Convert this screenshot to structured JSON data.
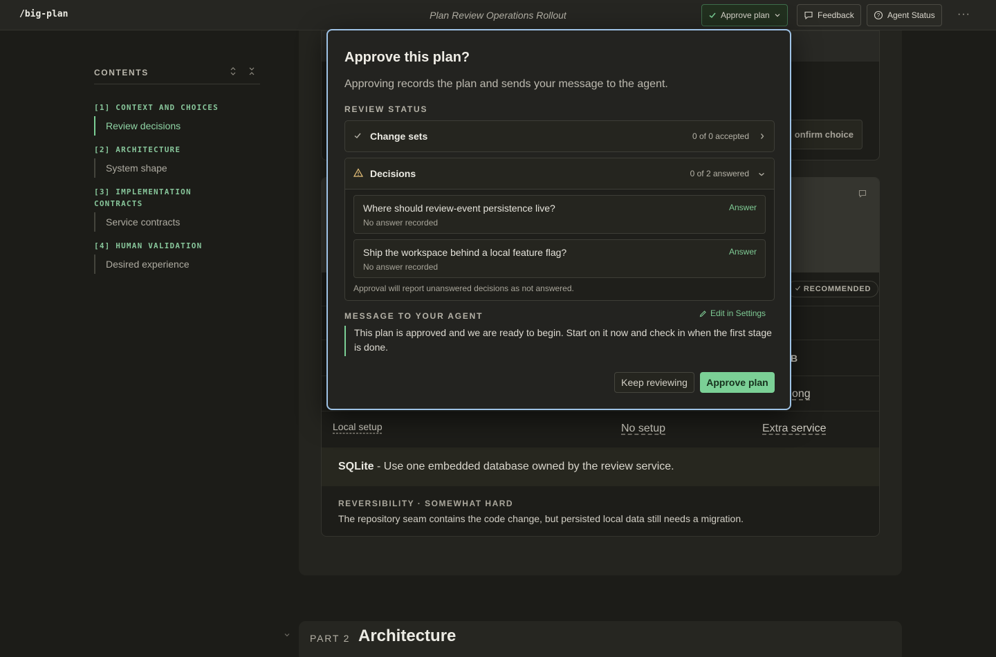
{
  "app": {
    "brand": "/big-plan",
    "title": "Plan Review Operations Rollout"
  },
  "toolbar": {
    "approve_label": "Approve plan",
    "feedback_label": "Feedback",
    "agent_status_label": "Agent Status",
    "more_label": "···"
  },
  "sidebar": {
    "heading": "CONTENTS",
    "sections": [
      {
        "title": "[1] CONTEXT AND CHOICES",
        "items": [
          "Review decisions"
        ]
      },
      {
        "title": "[2] ARCHITECTURE",
        "items": [
          "System shape"
        ]
      },
      {
        "title": "[3] IMPLEMENTATION CONTRACTS",
        "items": [
          "Service contracts"
        ]
      },
      {
        "title": "[4] HUMAN VALIDATION",
        "items": [
          "Desired experience"
        ]
      }
    ],
    "active_item": "Review decisions"
  },
  "background": {
    "confirm_choice": "onfirm choice",
    "recommended": "RECOMMENDED",
    "frag_b": "B",
    "frag_ong": "ong",
    "local_setup": {
      "label": "Local setup",
      "col_a": "No setup",
      "col_b": "Extra service"
    },
    "sqlite_name": "SQLite",
    "sqlite_desc": " - Use one embedded database owned by the review service.",
    "reversibility_label": "REVERSIBILITY · SOMEWHAT HARD",
    "reversibility_text": "The repository seam contains the code change, but persisted local data still needs a migration.",
    "part_label": "PART 2",
    "part_title": "Architecture"
  },
  "modal": {
    "title": "Approve this plan?",
    "subtitle": "Approving records the plan and sends your message to the agent.",
    "review_status_label": "REVIEW STATUS",
    "change_sets": {
      "label": "Change sets",
      "count": "0 of 0 accepted"
    },
    "decisions": {
      "label": "Decisions",
      "count": "0 of 2 answered",
      "items": [
        {
          "question": "Where should review-event persistence live?",
          "status": "No answer recorded",
          "action": "Answer"
        },
        {
          "question": "Ship the workspace behind a local feature flag?",
          "status": "No answer recorded",
          "action": "Answer"
        }
      ],
      "note": "Approval will report unanswered decisions as not answered."
    },
    "message_label": "MESSAGE TO YOUR AGENT",
    "edit_link": "Edit in Settings",
    "message": "This plan is approved and we are ready to begin. Start on it now and check in when the first stage is done.",
    "keep_label": "Keep reviewing",
    "approve_label": "Approve plan"
  },
  "colors": {
    "accent_green": "#7bd096",
    "modal_border": "#9fc3e6",
    "background": "#1c1c18"
  }
}
